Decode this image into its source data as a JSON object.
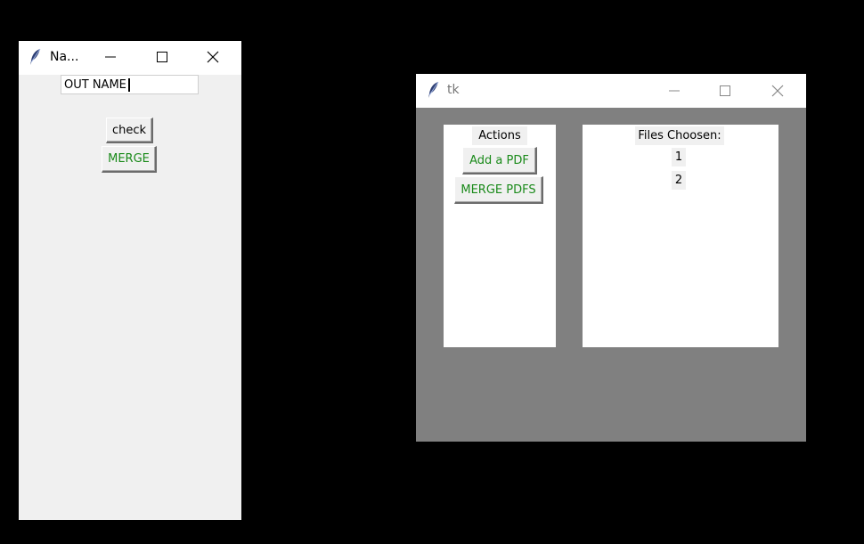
{
  "window1": {
    "title": "Na...",
    "entry_value": "OUT NAME",
    "check_label": "check",
    "merge_label": "MERGE"
  },
  "window2": {
    "title": "tk",
    "actions_label": "Actions",
    "add_pdf_label": "Add a PDF",
    "merge_pdfs_label": "MERGE PDFS",
    "files_label": "Files Choosen:",
    "files": [
      "1",
      "2"
    ]
  },
  "colors": {
    "desktop": "#000000",
    "window_bg": "#f0f0f0",
    "tk_gray_bg": "#808080",
    "button_green_text": "#1a8a1a"
  },
  "icons": {
    "app_icon": "feather-icon",
    "minimize": "minimize-icon",
    "maximize": "maximize-icon",
    "close": "close-icon"
  }
}
